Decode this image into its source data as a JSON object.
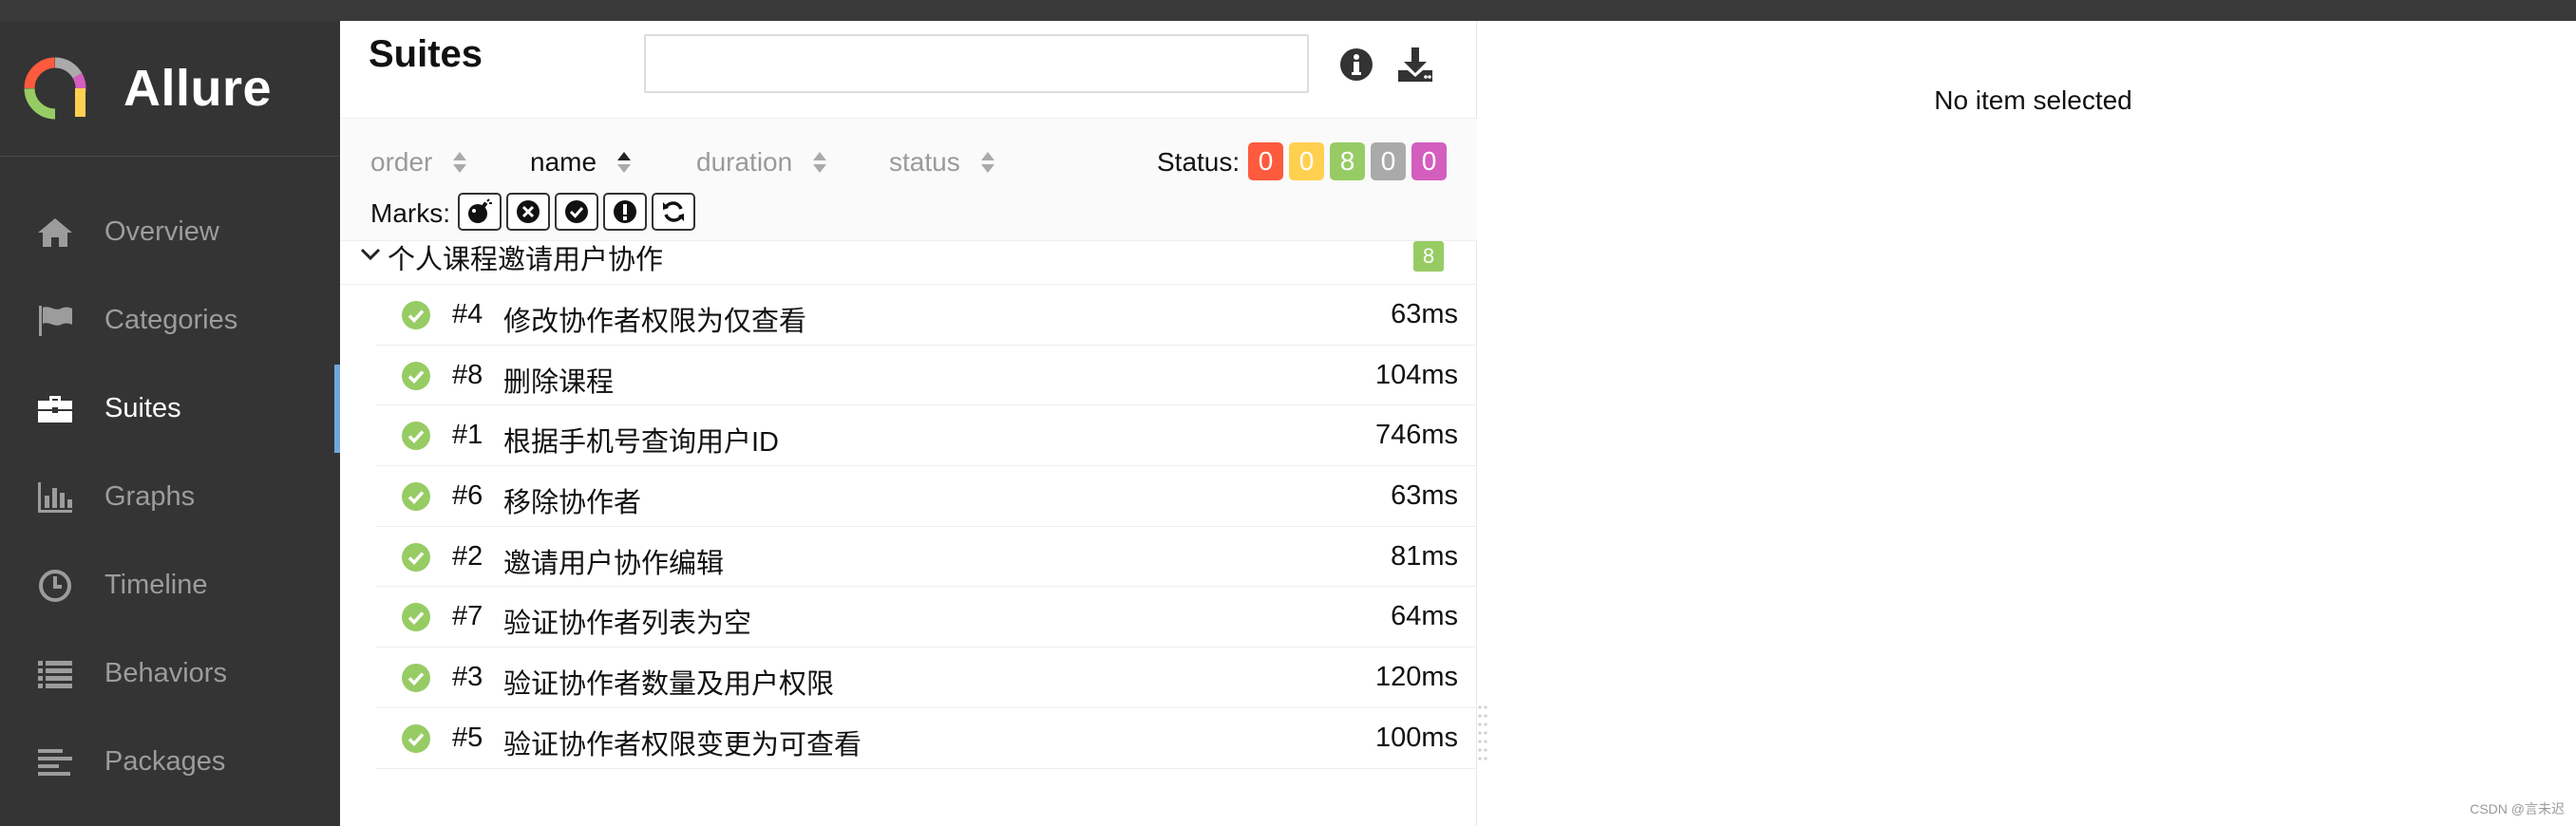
{
  "brand": {
    "name": "Allure"
  },
  "sidebar": {
    "items": [
      {
        "label": "Overview",
        "icon": "home-icon",
        "active": false
      },
      {
        "label": "Categories",
        "icon": "flag-icon",
        "active": false
      },
      {
        "label": "Suites",
        "icon": "briefcase-icon",
        "active": true
      },
      {
        "label": "Graphs",
        "icon": "bar-chart-icon",
        "active": false
      },
      {
        "label": "Timeline",
        "icon": "clock-icon",
        "active": false
      },
      {
        "label": "Behaviors",
        "icon": "list-icon",
        "active": false
      },
      {
        "label": "Packages",
        "icon": "align-left-icon",
        "active": false
      }
    ]
  },
  "tree": {
    "title": "Suites",
    "search": {
      "value": "",
      "placeholder": ""
    },
    "sorters": {
      "order": "order",
      "name": "name",
      "duration": "duration",
      "status": "status",
      "active": "name"
    },
    "status_label": "Status:",
    "status_counts": [
      {
        "value": "0",
        "color": "#fd5a3e",
        "name": "failed"
      },
      {
        "value": "0",
        "color": "#ffd050",
        "name": "broken"
      },
      {
        "value": "8",
        "color": "#97cc64",
        "name": "passed"
      },
      {
        "value": "0",
        "color": "#aaaaaa",
        "name": "skipped"
      },
      {
        "value": "0",
        "color": "#d35ebe",
        "name": "unknown"
      }
    ],
    "marks_label": "Marks:",
    "marks": [
      "flaky-icon",
      "new-failed-icon",
      "new-passed-icon",
      "new-broken-icon",
      "retries-icon"
    ],
    "group": {
      "name": "个人课程邀请用户协作",
      "count": "8"
    },
    "rows": [
      {
        "order": "#4",
        "name": "修改协作者权限为仅查看",
        "duration": "63ms"
      },
      {
        "order": "#8",
        "name": "删除课程",
        "duration": "104ms"
      },
      {
        "order": "#1",
        "name": "根据手机号查询用户ID",
        "duration": "746ms"
      },
      {
        "order": "#6",
        "name": "移除协作者",
        "duration": "63ms"
      },
      {
        "order": "#2",
        "name": "邀请用户协作编辑",
        "duration": "81ms"
      },
      {
        "order": "#7",
        "name": "验证协作者列表为空",
        "duration": "64ms"
      },
      {
        "order": "#3",
        "name": "验证协作者数量及用户权限",
        "duration": "120ms"
      },
      {
        "order": "#5",
        "name": "验证协作者权限变更为可查看",
        "duration": "100ms"
      }
    ]
  },
  "details": {
    "empty_message": "No item selected"
  },
  "watermark": "CSDN @言未迟",
  "colors": {
    "passed": "#97cc64",
    "active_nav_accent": "#6fa8dc",
    "sidebar_bg": "#343434"
  }
}
